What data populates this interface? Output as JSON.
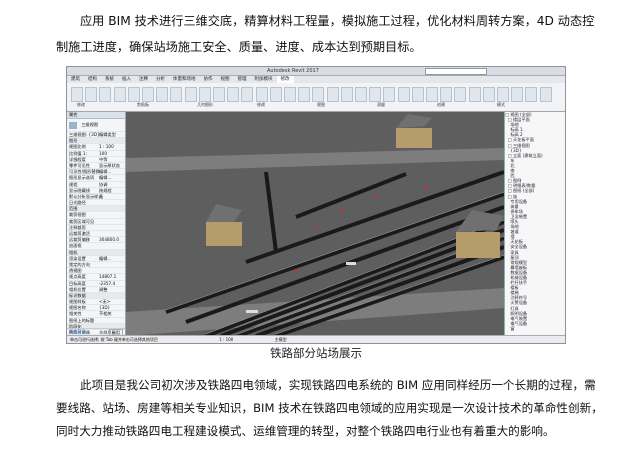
{
  "document": {
    "paragraph_1": "应用 BIM 技术进行三维交底，精算材料工程量，模拟施工过程，优化材料周转方案，4D 动态控制施工进度，确保站场施工安全、质量、进度、成本达到预期目标。",
    "caption": "铁路部分站场展示",
    "paragraph_2": "此项目是我公司初次涉及铁路四电领域，实现铁路四电系统的 BIM 应用同样经历一个长期的过程，需要线路、站场、房建等相关专业知识，BIM 技术在铁路四电领域的应用实现是一次设计技术的革命性创新，同时大力推动铁路四电工程建设模式、运维管理的转型，对整个铁路四电行业也有着重大的影响。"
  },
  "screenshot": {
    "window_title": "Autodesk Revit 2017",
    "ribbon_tabs": [
      "建筑",
      "结构",
      "系统",
      "插入",
      "注释",
      "分析",
      "体量和场地",
      "协作",
      "视图",
      "管理",
      "附加模块",
      "修改"
    ],
    "ribbon_groups": [
      "修改",
      "剪贴板",
      "几何图形",
      "修改",
      "视图",
      "测量",
      "创建",
      "模式"
    ],
    "properties_title": "属性",
    "properties_type": "三维视图",
    "properties_rows": [
      {
        "k": "三维视图: {3D}",
        "v": "编辑类型",
        "group": false
      },
      {
        "k": "图形",
        "v": "",
        "group": true
      },
      {
        "k": "视图比例",
        "v": "1 : 100",
        "group": false
      },
      {
        "k": "比例值 1:",
        "v": "100",
        "group": false
      },
      {
        "k": "详细程度",
        "v": "中等",
        "group": false
      },
      {
        "k": "零件可见性",
        "v": "显示原状态",
        "group": false
      },
      {
        "k": "可见性/图形替换",
        "v": "编辑...",
        "group": false
      },
      {
        "k": "图形显示选项",
        "v": "编辑...",
        "group": false
      },
      {
        "k": "规程",
        "v": "协调",
        "group": false
      },
      {
        "k": "显示隐藏线",
        "v": "按规程",
        "group": false
      },
      {
        "k": "默认分析显示样式",
        "v": "无",
        "group": false
      },
      {
        "k": "日光路径",
        "v": "",
        "group": false
      },
      {
        "k": "范围",
        "v": "",
        "group": true
      },
      {
        "k": "裁剪视图",
        "v": "",
        "group": false
      },
      {
        "k": "裁剪区域可见",
        "v": "",
        "group": false
      },
      {
        "k": "注释裁剪",
        "v": "",
        "group": false
      },
      {
        "k": "远裁剪激活",
        "v": "",
        "group": false
      },
      {
        "k": "远裁剪偏移",
        "v": "304800.0",
        "group": false
      },
      {
        "k": "剖面框",
        "v": "",
        "group": false
      },
      {
        "k": "相机",
        "v": "",
        "group": true
      },
      {
        "k": "渲染设置",
        "v": "编辑...",
        "group": false
      },
      {
        "k": "锁定的方向",
        "v": "",
        "group": false
      },
      {
        "k": "透视图",
        "v": "",
        "group": false
      },
      {
        "k": "视点高度",
        "v": "14807.1",
        "group": false
      },
      {
        "k": "目标高度",
        "v": "-2357.4",
        "group": false
      },
      {
        "k": "相机位置",
        "v": "调整",
        "group": false
      },
      {
        "k": "标识数据",
        "v": "",
        "group": true
      },
      {
        "k": "视图样板",
        "v": "<无>",
        "group": false
      },
      {
        "k": "视图名称",
        "v": "{3D}",
        "group": false
      },
      {
        "k": "相关性",
        "v": "不相关",
        "group": false
      },
      {
        "k": "图纸上的标题",
        "v": "",
        "group": false
      },
      {
        "k": "阶段化",
        "v": "",
        "group": true
      },
      {
        "k": "阶段过滤器",
        "v": "全部显示",
        "group": false
      },
      {
        "k": "相位",
        "v": "新构造",
        "group": false
      }
    ],
    "properties_help": "属性帮助",
    "apply_label": "应用",
    "browser_rows": [
      "□ 视图 (全部)",
      "  □ 楼层平面",
      "    场地",
      "    标高 1",
      "    标高 2",
      "  □ 天花板平面",
      "  □ 三维视图",
      "    {3D}",
      "  □ 立面 (建筑立面)",
      "    东",
      "    北",
      "    南",
      "    西",
      "  □ 图例",
      "  □ 明细表/数量",
      "  □ 图纸 (全部)",
      "  □ 族",
      "    专用设备",
      "    体量",
      "    停车场",
      "    卫浴装置",
      "    喷头",
      "    场地",
      "    坡道",
      "    墙",
      "    天花板",
      "    安全设备",
      "    家具",
      "    屋顶",
      "    常规模型",
      "    幕墙嵌板",
      "    数据设备",
      "    机械设备",
      "    栏杆扶手",
      "    楼板",
      "    楼梯",
      "    注释符号",
      "    火警设备",
      "    灯具",
      "    照明设备",
      "    电气装置",
      "    电气设备",
      "    窗"
    ],
    "status_text": "单击可进行选择; 按 Tab 键并单击可选择其他项目",
    "status_model": "主模型",
    "viewport_label": "1 : 100",
    "colors": {
      "viewport_bg": "#5e5e5e",
      "road": "#777777",
      "track": "#1c1c1c",
      "building_wall": "#b79c6b",
      "building_roof": "#6f6f6f"
    }
  }
}
